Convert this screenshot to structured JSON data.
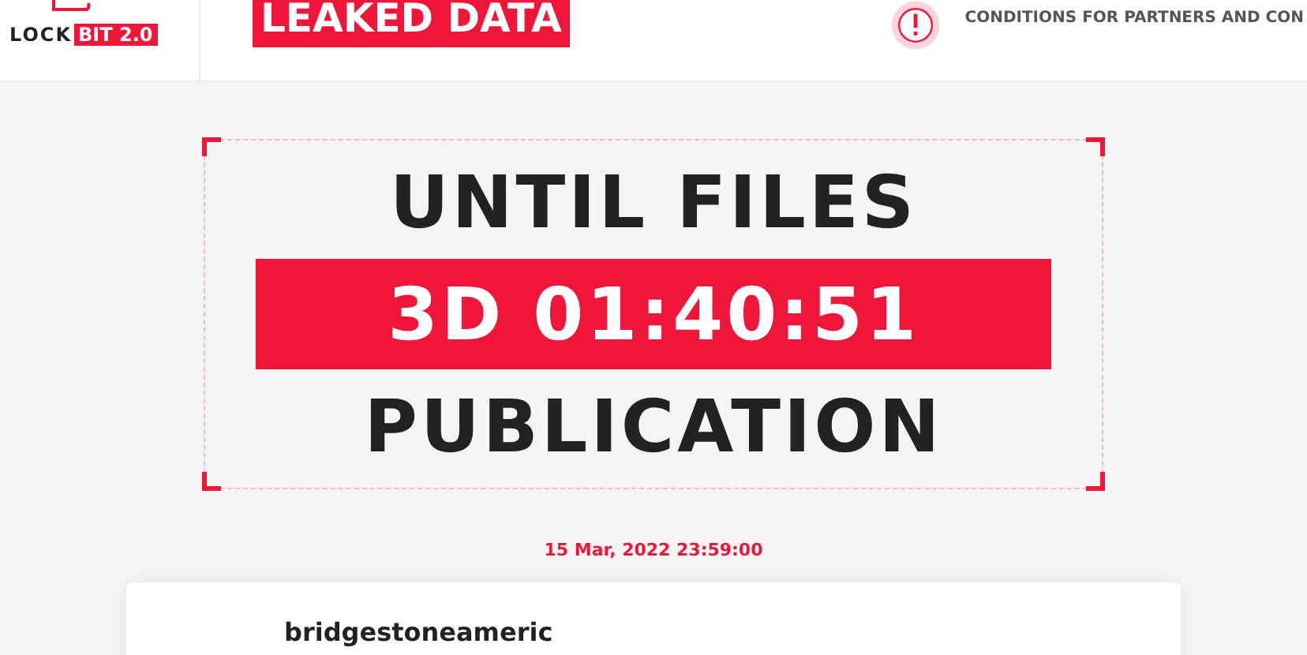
{
  "header": {
    "logo": {
      "word": "LOCK",
      "badge": "BIT 2.0"
    },
    "banner": "LEAKED DATA",
    "notice": "CONDITIONS FOR PARTNERS AND CON"
  },
  "countdown": {
    "top": "UNTIL FILES",
    "timer": "3D 01:40:51",
    "bottom": "PUBLICATION",
    "deadline": "15 Mar, 2022 23:59:00"
  },
  "post": {
    "title": "bridgestoneameric"
  }
}
